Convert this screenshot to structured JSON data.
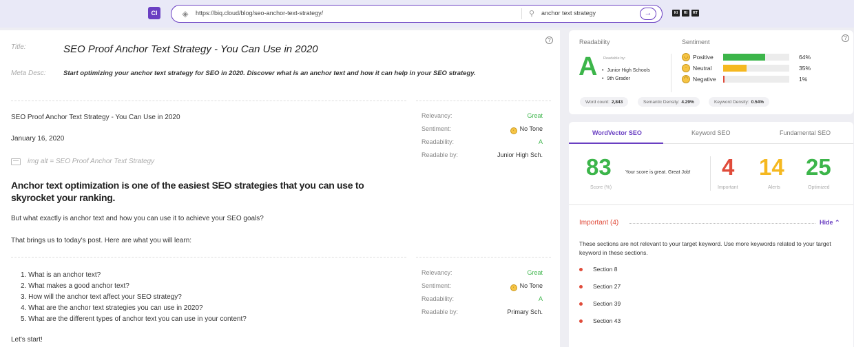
{
  "toolbar": {
    "ci_badge": "CI",
    "url": "https://biq.cloud/blog/seo-anchor-text-strategy/",
    "keyword": "anchor text strategy",
    "mini_badges": [
      "KI",
      "RI",
      "RT"
    ]
  },
  "meta": {
    "title_label": "Title:",
    "title": "SEO Proof Anchor Text Strategy - You Can Use in 2020",
    "desc_label": "Meta Desc:",
    "desc": "Start optimizing your anchor text strategy for SEO in 2020. Discover what is an anchor text and how it can help in your SEO strategy."
  },
  "content": {
    "heading_line": "SEO Proof Anchor Text Strategy - You Can Use in 2020",
    "date": "January 16, 2020",
    "img_alt": "img alt = SEO Proof Anchor Text Strategy",
    "h2": "Anchor text optimization is one of the easiest SEO strategies that you can use to skyrocket your ranking.",
    "p1": "But what exactly is anchor text and how you can use it to achieve your SEO goals?",
    "p2": "That brings us to today's post. Here are what you will learn:",
    "list": [
      "1. What is an anchor text?",
      "2. What makes a good anchor text?",
      "3. How will the anchor text affect your SEO strategy?",
      "4. What are the anchor text strategies you can use in 2020?",
      "5. What are the different types of anchor text you can use in your content?"
    ],
    "p3": "Let's start!"
  },
  "section_metrics": [
    {
      "relevancy_label": "Relevancy:",
      "relevancy": "Great",
      "sentiment_label": "Sentiment:",
      "sentiment": "No Tone",
      "readability_label": "Readability:",
      "readability": "A",
      "readable_by_label": "Readable by:",
      "readable_by": "Junior High Sch."
    },
    {
      "relevancy_label": "Relevancy:",
      "relevancy": "Great",
      "sentiment_label": "Sentiment:",
      "sentiment": "No Tone",
      "readability_label": "Readability:",
      "readability": "A",
      "readable_by_label": "Readable by:",
      "readable_by": "Primary Sch."
    }
  ],
  "readability": {
    "title": "Readability",
    "grade": "A",
    "readable_by_label": "Readable by:",
    "readable_by": [
      "Junior High Schools",
      "9th Grader"
    ]
  },
  "sentiment": {
    "title": "Sentiment",
    "rows": [
      {
        "label": "Positive",
        "pct": "64%",
        "value": 64,
        "color": "#3cb54a"
      },
      {
        "label": "Neutral",
        "pct": "35%",
        "value": 35,
        "color": "#f5b820"
      },
      {
        "label": "Negative",
        "pct": "1%",
        "value": 1,
        "color": "#e04b3a"
      }
    ]
  },
  "stats": {
    "word_count_label": "Word count:",
    "word_count": "2,843",
    "semantic_label": "Semantic Density:",
    "semantic": "4.29%",
    "keyword_label": "Keyword Density:",
    "keyword": "0.54%"
  },
  "tabs": [
    "WordVector SEO",
    "Keyword SEO",
    "Fundamental SEO"
  ],
  "scores": {
    "score": "83",
    "score_label": "Score (%)",
    "message": "Your score is great. Great Job!",
    "important": "4",
    "important_label": "Important",
    "alerts": "14",
    "alerts_label": "Alerts",
    "optimized": "25",
    "optimized_label": "Optimized",
    "colors": {
      "score": "#3cb54a",
      "important": "#e04b3a",
      "alerts": "#f5b820",
      "optimized": "#3cb54a"
    }
  },
  "important_section": {
    "title": "Important (4)",
    "hide": "Hide",
    "desc": "These sections are not relevant to your target keyword. Use more keywords related to your target keyword in these sections.",
    "items": [
      "Section 8",
      "Section 27",
      "Section 39",
      "Section 43"
    ]
  },
  "colors": {
    "accent": "#6a3fc2"
  }
}
